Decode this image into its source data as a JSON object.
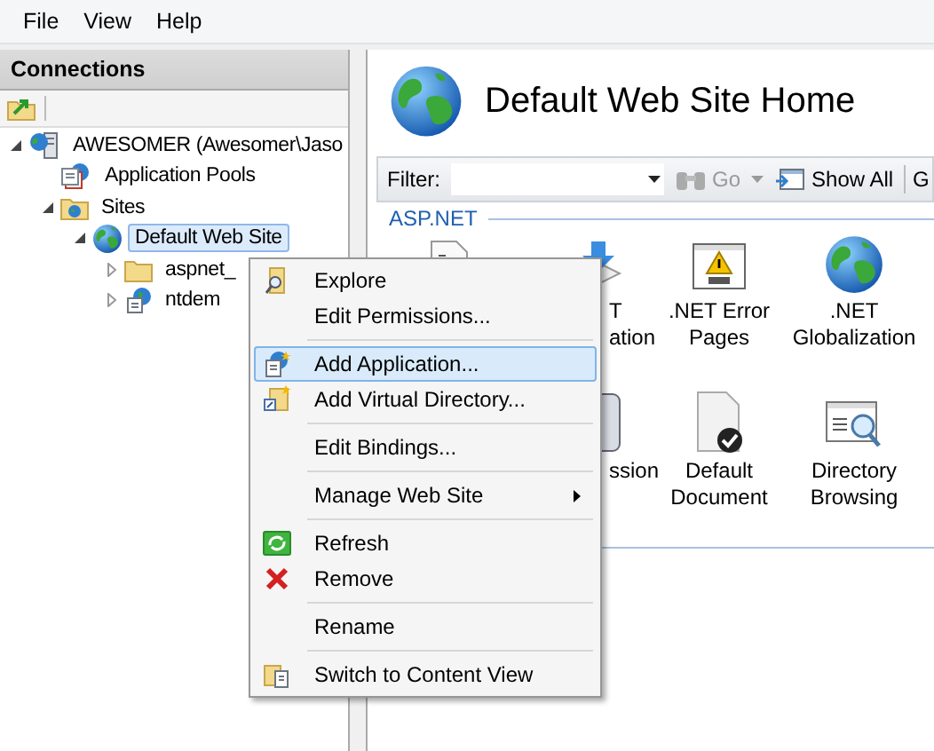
{
  "menu_bar": [
    {
      "label": "File"
    },
    {
      "label": "View"
    },
    {
      "label": "Help"
    }
  ],
  "connections": {
    "title": "Connections",
    "tree": [
      {
        "label": "AWESOMER (Awesomer\\Jaso",
        "kind": "server",
        "expanded": true,
        "selected": false,
        "children": [
          {
            "label": "Application Pools",
            "kind": "pools",
            "selected": false
          },
          {
            "label": "Sites",
            "kind": "sites",
            "expanded": true,
            "selected": false,
            "children": [
              {
                "label": "Default Web Site",
                "kind": "site",
                "expanded": true,
                "selected": true,
                "children": [
                  {
                    "label": "aspnet_",
                    "kind": "folder",
                    "expanded": false,
                    "selected": false
                  },
                  {
                    "label": "ntdem",
                    "kind": "app",
                    "expanded": false,
                    "selected": false
                  }
                ]
              }
            ]
          }
        ]
      }
    ]
  },
  "home": {
    "title": "Default Web Site Home",
    "filter": {
      "label": "Filter:",
      "go": "Go",
      "go_disabled": true,
      "show_all": "Show All",
      "group_by": "G"
    },
    "group": {
      "title": "ASP.NET",
      "rows": [
        [
          {
            "kind": "covered"
          },
          {
            "kind": "partial",
            "lines": [
              "T",
              "ation"
            ]
          },
          {
            "kind": "full",
            "lines": [
              ".NET Error",
              "Pages"
            ]
          },
          {
            "kind": "full",
            "lines": [
              ".NET",
              "Globalization"
            ]
          }
        ],
        [
          "",
          {
            "kind": "partial",
            "lines": [
              "ssion"
            ]
          },
          {
            "kind": "full",
            "lines": [
              "Default",
              "Document"
            ]
          },
          {
            "kind": "full",
            "lines": [
              "Directory",
              "Browsing"
            ]
          }
        ]
      ]
    }
  },
  "context_menu": {
    "items": [
      {
        "kind": "item",
        "label": "Explore",
        "selected": false
      },
      {
        "kind": "item",
        "label": "Edit Permissions...",
        "selected": false
      },
      {
        "kind": "separator"
      },
      {
        "kind": "item",
        "label": "Add Application...",
        "selected": true
      },
      {
        "kind": "item",
        "label": "Add Virtual Directory...",
        "selected": false
      },
      {
        "kind": "separator"
      },
      {
        "kind": "item",
        "label": "Edit Bindings...",
        "selected": false
      },
      {
        "kind": "separator"
      },
      {
        "kind": "item",
        "label": "Manage Web Site",
        "selected": false,
        "submenu": true
      },
      {
        "kind": "separator"
      },
      {
        "kind": "item",
        "label": "Refresh",
        "selected": false
      },
      {
        "kind": "item",
        "label": "Remove",
        "selected": false
      },
      {
        "kind": "separator"
      },
      {
        "kind": "item",
        "label": "Rename",
        "selected": false
      },
      {
        "kind": "separator"
      },
      {
        "kind": "item",
        "label": "Switch to Content View",
        "selected": false
      }
    ]
  }
}
